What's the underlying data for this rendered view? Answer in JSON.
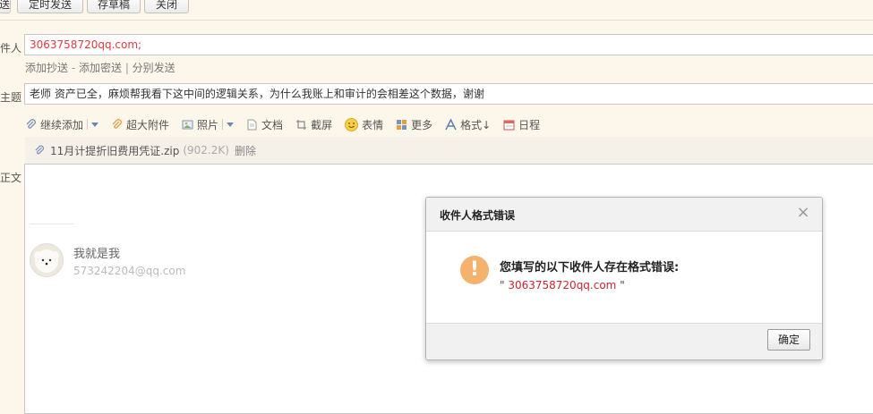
{
  "toolbar": {
    "btn_partial": "送",
    "scheduled_send": "定时发送",
    "save_draft": "存草稿",
    "close": "关闭"
  },
  "labels": {
    "to": "件人",
    "subject": "主题",
    "body": "正文"
  },
  "recipient": {
    "value": "3063758720qq.com;"
  },
  "links": {
    "cc": "添加抄送",
    "dash": " - ",
    "bcc": "添加密送",
    "pipe": " | ",
    "separate": "分别发送"
  },
  "subject": {
    "value": "老师 资产已全，麻烦帮我看下这中间的逻辑关系，为什么我账上和审计的会相差这个数据，谢谢"
  },
  "attach_toolbar": {
    "continue_attach": "继续添加",
    "large_attach": "超大附件",
    "photo": "照片",
    "document": "文档",
    "screenshot": "截屏",
    "emoji": "表情",
    "more": "更多",
    "format": "格式↓",
    "calendar": "日程"
  },
  "attachment": {
    "filename": "11月计提折旧费用凭证.zip",
    "size": "(902.2K)",
    "delete": "删除"
  },
  "signature": {
    "name": "我就是我",
    "email": "573242204@qq.com"
  },
  "dialog": {
    "title": "收件人格式错误",
    "message": "您填写的以下收件人存在格式错误:",
    "quote_open": "\" ",
    "address": "3063758720qq.com",
    "quote_close": " \"",
    "ok": "确定"
  },
  "colors": {
    "error_red": "#e03c3c",
    "warning_orange": "#f5b26c"
  }
}
